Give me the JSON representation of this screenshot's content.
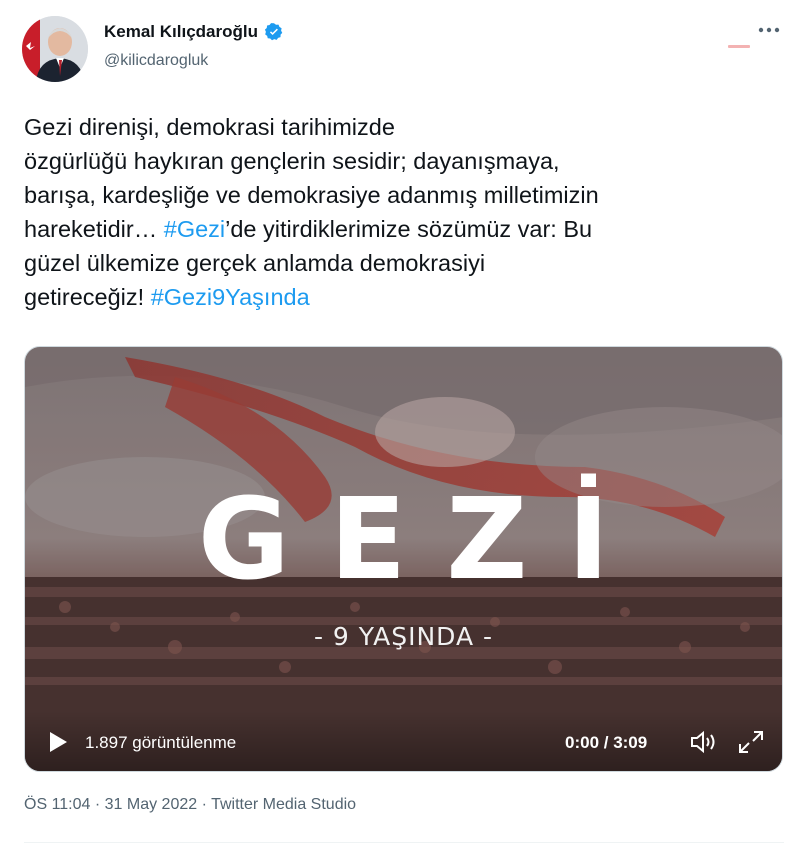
{
  "author": {
    "name": "Kemal Kılıçdaroğlu",
    "handle": "@kilicdarogluk",
    "verified": true
  },
  "tweet_lines": [
    {
      "text": "Gezi direnişi, demokrasi tarihimizde"
    },
    {
      "text": "özgürlüğü haykıran gençlerin sesidir; dayanışmaya,"
    },
    {
      "text": "barışa, kardeşliğe ve demokrasiye adanmış milletimizin"
    },
    {
      "before": "hareketidir… ",
      "hashtag": "#Gezi",
      "after": "’de yitirdiklerimize sözümüz var: Bu"
    },
    {
      "text": "güzel ülkemize gerçek anlamda demokrasiyi"
    },
    {
      "before": "getireceğiz! ",
      "hashtag": "#Gezi9Yaşında"
    }
  ],
  "video": {
    "title_text": "GEZİ",
    "subtitle_text": "- 9 YAŞINDA -",
    "views": "1.897 görüntülenme",
    "time": "0:00 / 3:09"
  },
  "meta": {
    "time": "ÖS 11:04",
    "sep1": " · ",
    "date": "31 May 2022",
    "sep2": " · ",
    "source": "Twitter Media Studio"
  },
  "colors": {
    "link": "#1d9bf0",
    "verified": "#1d9bf0",
    "muted": "#536471"
  },
  "icons": {
    "more": "more-icon",
    "verified": "verified-badge-icon",
    "play": "play-icon",
    "volume": "volume-icon",
    "expand": "expand-icon"
  }
}
